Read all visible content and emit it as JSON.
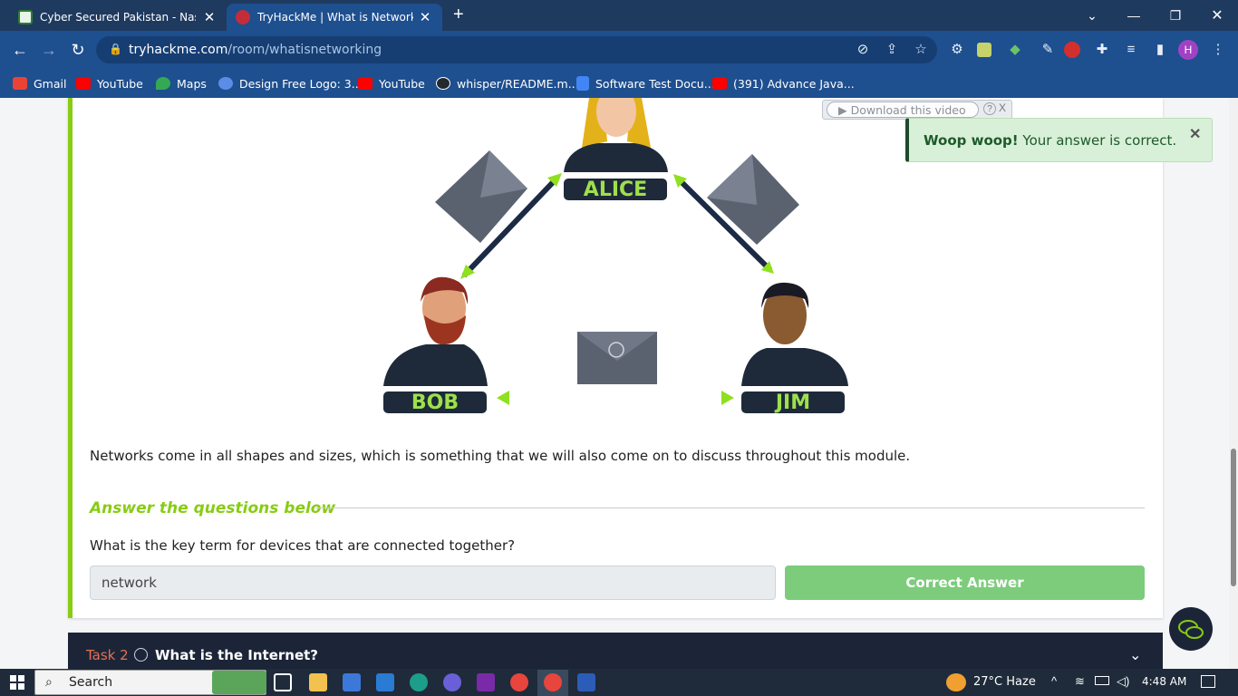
{
  "browser": {
    "tabs": [
      {
        "title": "Cyber Secured Pakistan - Nas.io |",
        "close": "✕"
      },
      {
        "title": "TryHackMe | What is Networking",
        "close": "✕"
      }
    ],
    "new_tab": "+",
    "window_controls": {
      "chevron": "⌄",
      "minimize": "—",
      "restore": "❐",
      "close": "✕"
    },
    "url_host": "tryhackme.com",
    "url_path": "/room/whatisnetworking",
    "profile_initial": "H",
    "bookmarks": [
      {
        "label": "Gmail",
        "color": "#ea4335"
      },
      {
        "label": "YouTube",
        "color": "#ff0000"
      },
      {
        "label": "Maps",
        "color": "#34a853"
      },
      {
        "label": "Design Free Logo: 3...",
        "color": "#5b8de8"
      },
      {
        "label": "YouTube",
        "color": "#ff0000"
      },
      {
        "label": "whisper/README.m...",
        "color": "#24292f"
      },
      {
        "label": "Software Test Docu...",
        "color": "#4285f4"
      },
      {
        "label": "(391) Advance Java...",
        "color": "#ff0000"
      }
    ]
  },
  "download_widget": {
    "label": "▶ Download this video",
    "help": "?",
    "close": "X"
  },
  "toast": {
    "bold": "Woop woop!",
    "text": " Your answer is correct.",
    "close": "✕"
  },
  "diagram": {
    "alice": "ALICE",
    "bob": "BOB",
    "jim": "JIM"
  },
  "content": {
    "paragraph": "Networks come in all shapes and sizes, which is something that we will also come on to discuss throughout this module.",
    "answer_heading": "Answer the questions below",
    "question": "What is the key term for devices that are connected together?",
    "answer_value": "network",
    "correct_button": "Correct Answer"
  },
  "task2": {
    "label": "Task 2",
    "title": "What is the Internet?",
    "chevron": "⌄"
  },
  "taskbar": {
    "search_placeholder": "Search",
    "weather": "27°C  Haze",
    "time": "4:48 AM"
  },
  "colors": {
    "accent_green": "#88cc14",
    "toast_bg": "#d8f0d8",
    "correct_btn": "#7ccc7c",
    "browser_blue": "#1e4f8f"
  }
}
